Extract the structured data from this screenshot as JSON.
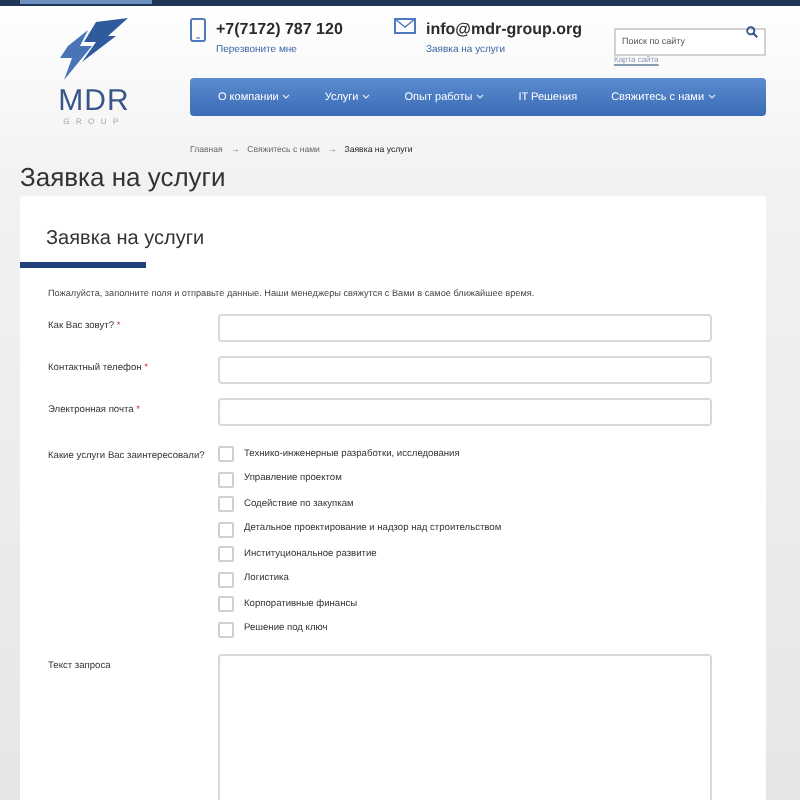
{
  "header": {
    "logo": {
      "name": "MDR",
      "tagline": "GROUP"
    },
    "phone": {
      "number": "+7(7172) 787 120",
      "link": "Перезвоните мне"
    },
    "email": {
      "address": "info@mdr-group.org",
      "link": "Заявка на услуги"
    },
    "search": {
      "placeholder": "Поиск по сайту"
    },
    "sitemap_link": "Карта сайта"
  },
  "nav": [
    {
      "label": "О компании",
      "has_dropdown": true
    },
    {
      "label": "Услуги",
      "has_dropdown": true
    },
    {
      "label": "Опыт работы",
      "has_dropdown": true
    },
    {
      "label": "IT Решения",
      "has_dropdown": false
    },
    {
      "label": "Свяжитесь с нами",
      "has_dropdown": true
    }
  ],
  "breadcrumb": [
    {
      "kind": "link",
      "text": "Главная"
    },
    {
      "kind": "separator",
      "text": "→"
    },
    {
      "kind": "link",
      "text": "Свяжитесь с нами"
    },
    {
      "kind": "separator",
      "text": "→"
    },
    {
      "kind": "current",
      "text": "Заявка на услуги"
    }
  ],
  "page_title": "Заявка на услуги",
  "form": {
    "title": "Заявка на услуги",
    "intro": "Пожалуйста, заполните поля и отправьте данные. Наши менеджеры свяжутся с Вами в самое ближайшее время.",
    "fields": [
      {
        "label": "Как Вас зовут?",
        "required_mark": "*"
      },
      {
        "label": "Контактный телефон",
        "required_mark": "*"
      },
      {
        "label": "Электронная почта",
        "required_mark": "*"
      }
    ],
    "services": {
      "label": "Какие услуги Вас заинтересовали?",
      "options": [
        {
          "label": "Технико-инженерные разработки, исследования",
          "checked": false
        },
        {
          "label": "Управление проектом",
          "checked": false
        },
        {
          "label": "Содействие по закупкам",
          "checked": false
        },
        {
          "label": "Детальное проектирование и надзор над строительством",
          "checked": false
        },
        {
          "label": "Институциональное развитие",
          "checked": false
        },
        {
          "label": "Логистика",
          "checked": false
        },
        {
          "label": "Корпоративные финансы",
          "checked": false
        },
        {
          "label": "Решение под ключ",
          "checked": false
        }
      ]
    },
    "message": {
      "label": "Текст запроса"
    }
  }
}
